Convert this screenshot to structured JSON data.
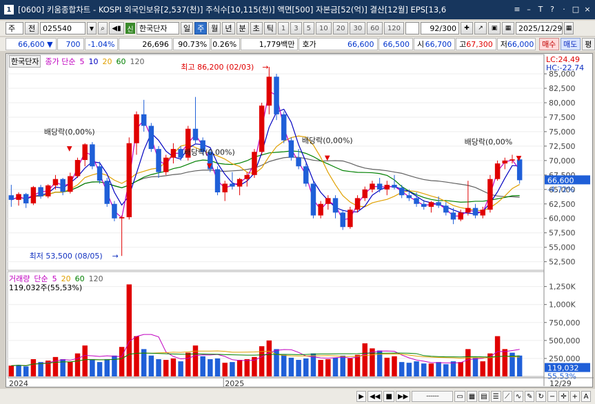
{
  "window": {
    "num": "1",
    "title": "[0600] 키움종합차트 - KOSPI 외국인보유[2,537(천)] 주식수[10,115(천)] 액면[500] 자본금[52(억)] 결산[12월] EPS[13,6",
    "buttons": [
      "≡",
      "–",
      "T",
      "?",
      "·",
      "□",
      "×"
    ]
  },
  "toolbar": {
    "type": "주",
    "prev": "전",
    "code": "025540",
    "vol_icon": "volume-icon",
    "market_badge": "신",
    "name": "한국단자",
    "periods": [
      "일",
      "주",
      "월",
      "년",
      "분",
      "초",
      "틱"
    ],
    "active_period": "주",
    "numbers": [
      "1",
      "3",
      "5",
      "10",
      "20",
      "30",
      "60",
      "120"
    ],
    "count": "92",
    "count_total": "/300",
    "date": "2025/12/29"
  },
  "quote": {
    "price": "66,600",
    "arrow": "▼",
    "change": "700",
    "change_pct": "-1.04%",
    "volume": "26,696",
    "vol_ratio": "90.73%",
    "turnover": "0.26%",
    "amount": "1,779백만",
    "ask_label": "호가",
    "ask": "66,600",
    "bid": "66,500",
    "open_label": "시",
    "open": "66,700",
    "high_label": "고",
    "high": "67,300",
    "low_label": "저",
    "low": "66,000",
    "buy": "매수",
    "sell": "매도",
    "flat": "평"
  },
  "price_panel": {
    "name_tag": "한국단자",
    "ma_label": "종가 단순",
    "ma_periods": [
      "5",
      "10",
      "20",
      "60",
      "120"
    ],
    "lc_label": "LC:24.49",
    "hc_label": "HC:-22.74",
    "current_label": "66,600",
    "current_pct": "-4.72%",
    "high_note": "최고 86,200 (02/03)",
    "low_note": "최저 53,500 (08/05)",
    "dividend_note": "배당락(0,00%)",
    "dividend_note2": "배당락(0,00%"
  },
  "volume_panel": {
    "name": "거래량",
    "ma_label": "단순",
    "ma_periods": [
      "5",
      "20",
      "60",
      "120"
    ],
    "value_label": "119,032주(55,53%)",
    "current_label": "119,032",
    "current_pct": "55.53%"
  },
  "x_axis": {
    "labels": [
      "2024",
      "2025"
    ],
    "last_label": "12/29"
  },
  "colors": {
    "up": "#e00000",
    "down": "#1f5fd8",
    "ma5": "#c000c0",
    "ma10": "#0000c0",
    "ma20": "#e0a000",
    "ma60": "#008000",
    "ma120": "#606060"
  },
  "chart_data": {
    "type": "candlestick",
    "title": "",
    "y_ticks": [
      "85,000",
      "82,500",
      "80,000",
      "77,500",
      "75,000",
      "72,500",
      "70,000",
      "67,500",
      "65,000",
      "62,500",
      "60,000",
      "57,500",
      "55,000",
      "52,500"
    ],
    "ylim": [
      51500,
      86800
    ],
    "vol_ticks": [
      "1,250K",
      "1,000K",
      "750,000",
      "500,000",
      "250,000"
    ],
    "vol_ylim": [
      0,
      1400000
    ],
    "candles": [
      [
        64000,
        65800,
        62000,
        63200
      ],
      [
        63200,
        64500,
        62200,
        64200
      ],
      [
        64200,
        64400,
        61800,
        62600
      ],
      [
        62600,
        65600,
        62300,
        65400
      ],
      [
        65400,
        65800,
        63400,
        63800
      ],
      [
        63800,
        65900,
        63500,
        65700
      ],
      [
        65700,
        67500,
        65000,
        66800
      ],
      [
        66800,
        67000,
        64000,
        64600
      ],
      [
        64600,
        67900,
        64300,
        67300
      ],
      [
        67300,
        70500,
        67000,
        70100
      ],
      [
        70100,
        73000,
        69000,
        72800
      ],
      [
        72800,
        73200,
        68500,
        69000
      ],
      [
        69000,
        69800,
        66000,
        66500
      ],
      [
        66500,
        67000,
        62000,
        62500
      ],
      [
        62500,
        63000,
        59500,
        60000
      ],
      [
        60000,
        60500,
        53500,
        60200
      ],
      [
        60200,
        74000,
        59800,
        73000
      ],
      [
        73000,
        78500,
        71000,
        78000
      ],
      [
        78000,
        80500,
        75000,
        76000
      ],
      [
        76000,
        76500,
        71500,
        72000
      ],
      [
        72000,
        72500,
        67000,
        68000
      ],
      [
        68000,
        71000,
        67500,
        70500
      ],
      [
        70500,
        73000,
        69500,
        72000
      ],
      [
        72000,
        72500,
        70000,
        70500
      ],
      [
        70500,
        76000,
        70000,
        75500
      ],
      [
        75500,
        81000,
        73000,
        73500
      ],
      [
        73500,
        74000,
        71000,
        71500
      ],
      [
        71500,
        72000,
        68000,
        68500
      ],
      [
        68500,
        69000,
        64000,
        64500
      ],
      [
        64500,
        66500,
        63000,
        66000
      ],
      [
        66000,
        68000,
        65000,
        65500
      ],
      [
        65500,
        67000,
        64000,
        66800
      ],
      [
        66800,
        68000,
        65500,
        67500
      ],
      [
        67500,
        72000,
        67000,
        71500
      ],
      [
        71500,
        80000,
        71000,
        79500
      ],
      [
        79500,
        86200,
        78000,
        84500
      ],
      [
        84500,
        85000,
        77000,
        78000
      ],
      [
        78000,
        78500,
        73000,
        73500
      ],
      [
        73500,
        74000,
        70000,
        70500
      ],
      [
        70500,
        72000,
        68500,
        69000
      ],
      [
        69000,
        69500,
        65500,
        66000
      ],
      [
        66000,
        66500,
        60000,
        60500
      ],
      [
        60500,
        63000,
        60000,
        62500
      ],
      [
        62500,
        64000,
        61500,
        63500
      ],
      [
        63500,
        64000,
        60000,
        61000
      ],
      [
        61000,
        61500,
        58000,
        58500
      ],
      [
        58500,
        62000,
        58200,
        61500
      ],
      [
        61500,
        64000,
        61000,
        63500
      ],
      [
        63500,
        65500,
        63000,
        65000
      ],
      [
        65000,
        66500,
        64500,
        66000
      ],
      [
        66000,
        67000,
        64500,
        65000
      ],
      [
        65000,
        66500,
        64000,
        65800
      ],
      [
        65800,
        67500,
        65000,
        65300
      ],
      [
        65300,
        65800,
        63500,
        64000
      ],
      [
        64000,
        65000,
        63000,
        63500
      ],
      [
        63500,
        64500,
        62000,
        62500
      ],
      [
        62500,
        63200,
        61500,
        62000
      ],
      [
        62000,
        63000,
        61000,
        62800
      ],
      [
        62800,
        63800,
        61800,
        62200
      ],
      [
        62200,
        62800,
        60500,
        61000
      ],
      [
        61000,
        61800,
        59000,
        59800
      ],
      [
        59800,
        61500,
        59500,
        61000
      ],
      [
        61000,
        66500,
        60500,
        61800
      ],
      [
        61800,
        62500,
        60000,
        60500
      ],
      [
        60500,
        62000,
        60000,
        61500
      ],
      [
        61500,
        67500,
        61000,
        66800
      ],
      [
        66800,
        70000,
        66500,
        69500
      ],
      [
        69500,
        70500,
        68500,
        70000
      ],
      [
        70000,
        71000,
        69500,
        70200
      ],
      [
        70200,
        70600,
        66000,
        66600
      ]
    ],
    "volumes": [
      [
        150000,
        1
      ],
      [
        160000,
        0
      ],
      [
        140000,
        0
      ],
      [
        240000,
        1
      ],
      [
        200000,
        0
      ],
      [
        220000,
        1
      ],
      [
        270000,
        1
      ],
      [
        240000,
        0
      ],
      [
        200000,
        1
      ],
      [
        320000,
        1
      ],
      [
        430000,
        1
      ],
      [
        240000,
        0
      ],
      [
        200000,
        0
      ],
      [
        240000,
        0
      ],
      [
        290000,
        0
      ],
      [
        410000,
        1
      ],
      [
        1280000,
        1
      ],
      [
        560000,
        1
      ],
      [
        380000,
        0
      ],
      [
        290000,
        0
      ],
      [
        240000,
        0
      ],
      [
        230000,
        1
      ],
      [
        250000,
        1
      ],
      [
        210000,
        0
      ],
      [
        330000,
        1
      ],
      [
        430000,
        1
      ],
      [
        280000,
        0
      ],
      [
        240000,
        0
      ],
      [
        250000,
        0
      ],
      [
        190000,
        1
      ],
      [
        200000,
        0
      ],
      [
        230000,
        1
      ],
      [
        240000,
        1
      ],
      [
        270000,
        1
      ],
      [
        420000,
        1
      ],
      [
        500000,
        1
      ],
      [
        380000,
        0
      ],
      [
        300000,
        0
      ],
      [
        260000,
        0
      ],
      [
        230000,
        0
      ],
      [
        250000,
        0
      ],
      [
        320000,
        0
      ],
      [
        230000,
        1
      ],
      [
        240000,
        1
      ],
      [
        260000,
        0
      ],
      [
        290000,
        0
      ],
      [
        250000,
        1
      ],
      [
        300000,
        1
      ],
      [
        460000,
        1
      ],
      [
        390000,
        1
      ],
      [
        360000,
        0
      ],
      [
        260000,
        1
      ],
      [
        280000,
        1
      ],
      [
        200000,
        0
      ],
      [
        190000,
        0
      ],
      [
        210000,
        0
      ],
      [
        180000,
        0
      ],
      [
        180000,
        1
      ],
      [
        200000,
        0
      ],
      [
        170000,
        0
      ],
      [
        210000,
        0
      ],
      [
        200000,
        1
      ],
      [
        380000,
        1
      ],
      [
        260000,
        0
      ],
      [
        210000,
        1
      ],
      [
        320000,
        1
      ],
      [
        560000,
        1
      ],
      [
        380000,
        1
      ],
      [
        330000,
        0
      ],
      [
        290000,
        0
      ]
    ]
  }
}
